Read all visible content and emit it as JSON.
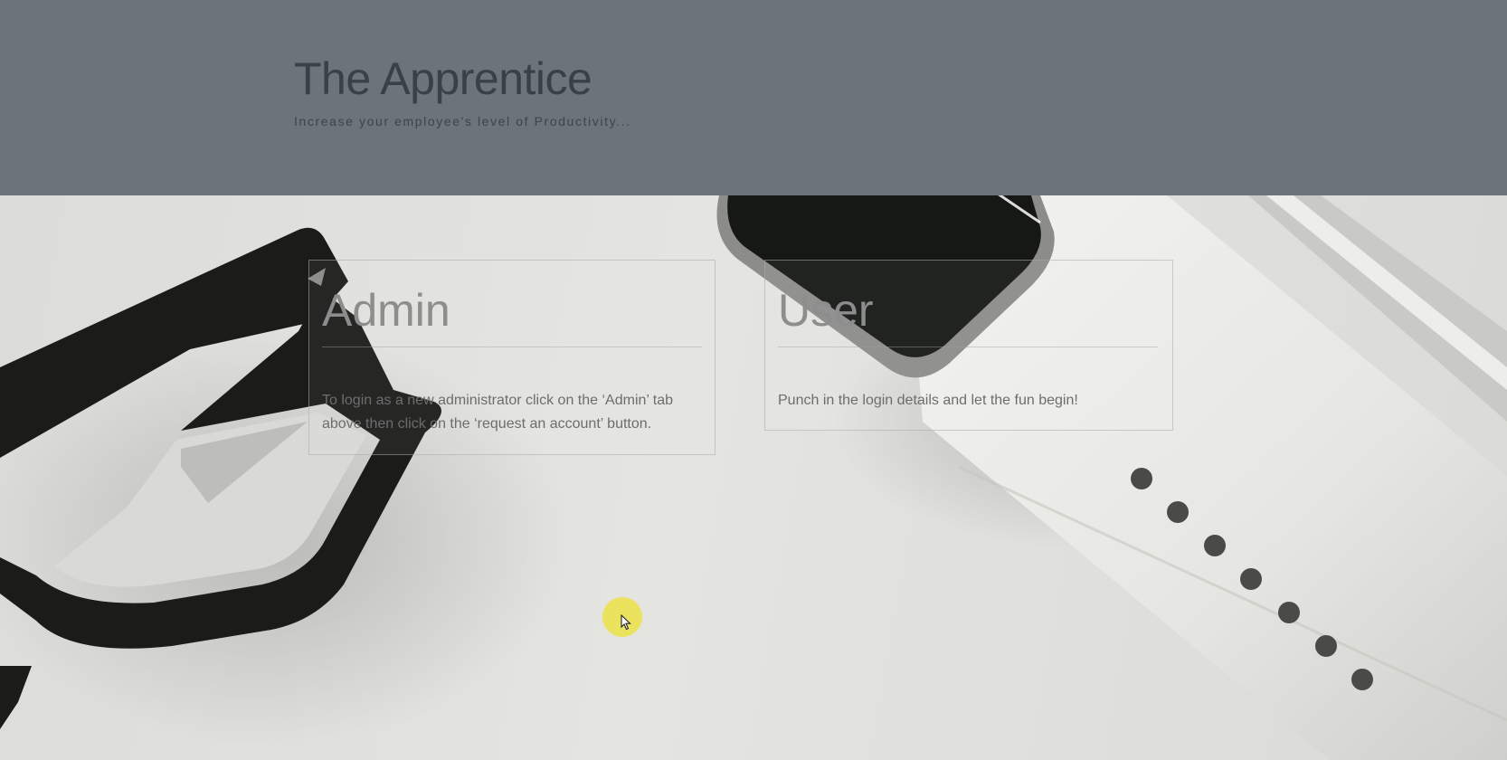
{
  "header": {
    "title": "The Apprentice",
    "tagline": "Increase your employee's level of Productivity..."
  },
  "cards": {
    "admin": {
      "heading": "Admin",
      "text": "To login as a new administrator click on the ‘Admin’ tab above then click on the ‘request an account’ button."
    },
    "user": {
      "heading": "User",
      "text": "Punch in the login details and let the fun begin!"
    }
  },
  "icons": {
    "cursor": "mouse-pointer-icon"
  },
  "colors": {
    "header_bg": "#6b737b",
    "cursor_highlight": "#ece246"
  }
}
